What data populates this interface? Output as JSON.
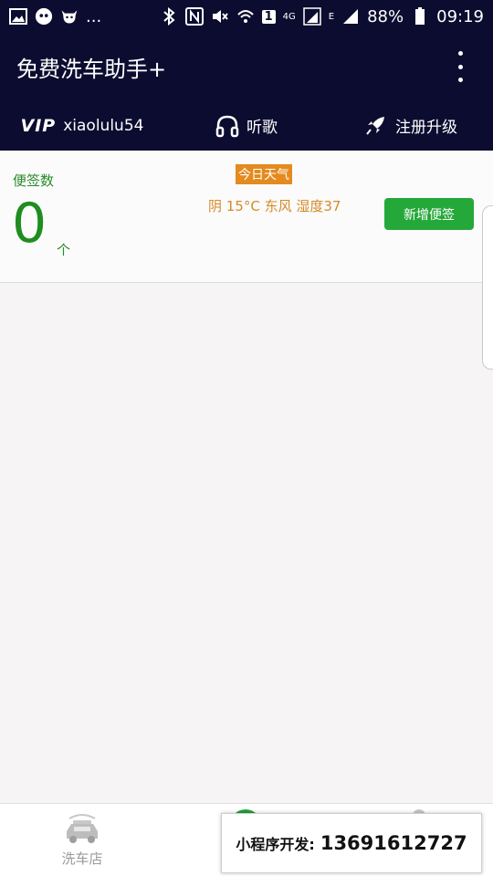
{
  "status": {
    "dots": "...",
    "sim_number": "1",
    "net_4g": "4G",
    "net_e": "E",
    "battery": "88%",
    "time": "09:19"
  },
  "appbar": {
    "title": "免费洗车助手+"
  },
  "nav": {
    "vip_badge": "VIP",
    "username": "xiaolulu54",
    "music": "听歌",
    "upgrade": "注册升级"
  },
  "notes": {
    "label": "便签数",
    "count": "0",
    "unit": "个",
    "add_button": "新增便签"
  },
  "weather": {
    "title": "今日天气",
    "text": "阴 15°C 东风 湿度37"
  },
  "bottom": {
    "shop_label": "洗车店",
    "promo_label": "小程序开发:",
    "promo_phone": "13691612727"
  },
  "colors": {
    "header_bg": "#0c0c30",
    "accent_green": "#25a83a",
    "weather_orange": "#e48a1f"
  }
}
